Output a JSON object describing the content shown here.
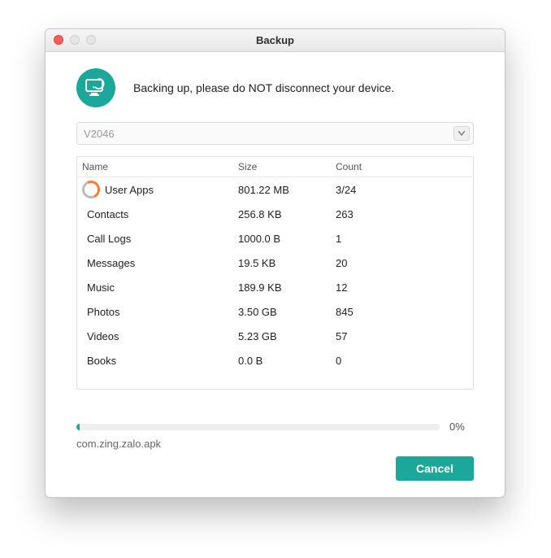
{
  "window": {
    "title": "Backup"
  },
  "header": {
    "message": "Backing up, please do NOT disconnect your device."
  },
  "device": {
    "selected": "V2046"
  },
  "table": {
    "headers": {
      "name": "Name",
      "size": "Size",
      "count": "Count"
    },
    "rows": [
      {
        "name": "User Apps",
        "size": "801.22 MB",
        "count": "3/24",
        "loading": true
      },
      {
        "name": "Contacts",
        "size": "256.8 KB",
        "count": "263",
        "loading": false
      },
      {
        "name": "Call Logs",
        "size": "1000.0 B",
        "count": "1",
        "loading": false
      },
      {
        "name": "Messages",
        "size": "19.5 KB",
        "count": "20",
        "loading": false
      },
      {
        "name": "Music",
        "size": "189.9 KB",
        "count": "12",
        "loading": false
      },
      {
        "name": "Photos",
        "size": "3.50 GB",
        "count": "845",
        "loading": false
      },
      {
        "name": "Videos",
        "size": "5.23 GB",
        "count": "57",
        "loading": false
      },
      {
        "name": "Books",
        "size": "0.0 B",
        "count": "0",
        "loading": false
      }
    ]
  },
  "progress": {
    "percent": 0,
    "percent_label": "0%",
    "current_file": "com.zing.zalo.apk"
  },
  "buttons": {
    "cancel": "Cancel"
  },
  "colors": {
    "accent": "#1ba89b",
    "spinner": "#ff7a2f"
  }
}
